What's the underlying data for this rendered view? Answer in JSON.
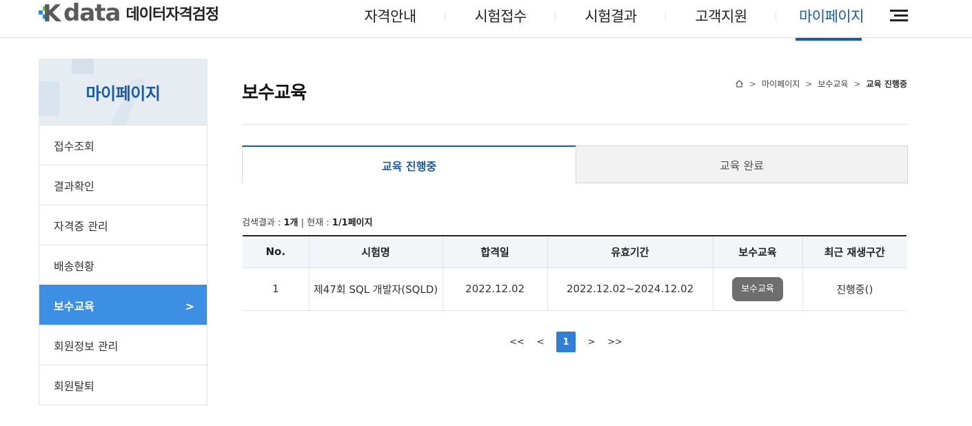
{
  "header": {
    "logo_letter": "K",
    "logo_word": "data",
    "logo_sub": "데이터자격검정",
    "nav": [
      {
        "label": "자격안내"
      },
      {
        "label": "시험접수"
      },
      {
        "label": "시험결과"
      },
      {
        "label": "고객지원"
      },
      {
        "label": "마이페이지"
      }
    ],
    "active_nav": "마이페이지"
  },
  "sidebar": {
    "title": "마이페이지",
    "items": [
      {
        "label": "접수조회"
      },
      {
        "label": "결과확인"
      },
      {
        "label": "자격증 관리"
      },
      {
        "label": "배송현황"
      },
      {
        "label": "보수교육",
        "chevron": ">"
      },
      {
        "label": "회원정보 관리"
      },
      {
        "label": "회원탈퇴"
      }
    ],
    "active_item": "보수교육"
  },
  "content": {
    "title": "보수교육",
    "breadcrumb": [
      "마이페이지",
      "보수교육",
      "교육 진행중"
    ],
    "tabs": [
      {
        "label": "교육 진행중"
      },
      {
        "label": "교육 완료"
      }
    ],
    "active_tab": "교육 진행중",
    "result": {
      "prefix": "검색결과 : ",
      "count": "1개",
      "mid": " | 현재 : ",
      "page": "1/1페이지"
    },
    "table": {
      "headers": [
        "No.",
        "시험명",
        "합격일",
        "유효기간",
        "보수교육",
        "최근 재생구간"
      ],
      "rows": [
        {
          "no": "1",
          "exam": "제47회 SQL 개발자(SQLD)",
          "pass_date": "2022.12.02",
          "valid": "2022.12.02~2024.12.02",
          "button": "보수교육",
          "recent": "진행중()"
        }
      ]
    },
    "pagination": {
      "first": "<<",
      "prev": "<",
      "current": "1",
      "next": ">",
      "last": ">>"
    }
  },
  "colors": {
    "brand_blue": "#1a5ba8",
    "sidebar_active": "#3d8fe3",
    "page_current": "#2f7fd6",
    "button_gray": "#6e6e6e",
    "logo_green": "#6cc04a",
    "logo_blue": "#2b8ad9"
  },
  "icons": {
    "home": "home-icon",
    "menu": "hamburger-icon",
    "chevron": "chevron-right-icon"
  }
}
